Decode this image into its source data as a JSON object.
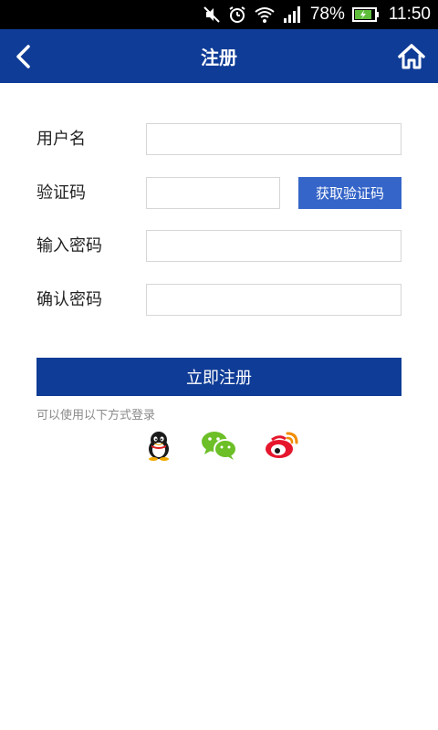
{
  "status_bar": {
    "battery_percent": "78%",
    "time": "11:50",
    "icons": [
      "mute-icon",
      "alarm-icon",
      "wifi-icon",
      "signal-icon",
      "battery-icon"
    ]
  },
  "header": {
    "title": "注册",
    "back_icon": "chevron-left-icon",
    "home_icon": "home-icon"
  },
  "form": {
    "username": {
      "label": "用户名",
      "value": "",
      "placeholder": ""
    },
    "verification_code": {
      "label": "验证码",
      "value": "",
      "placeholder": "",
      "button_label": "获取验证码"
    },
    "password": {
      "label": "输入密码",
      "value": "",
      "placeholder": ""
    },
    "confirm_password": {
      "label": "确认密码",
      "value": "",
      "placeholder": ""
    }
  },
  "actions": {
    "submit_label": "立即注册"
  },
  "social_login": {
    "hint": "可以使用以下方式登录",
    "providers": [
      "qq-icon",
      "wechat-icon",
      "weibo-icon"
    ]
  },
  "colors": {
    "primary": "#0f3c96",
    "code_button": "#3565c8",
    "status_bar": "#000000"
  }
}
